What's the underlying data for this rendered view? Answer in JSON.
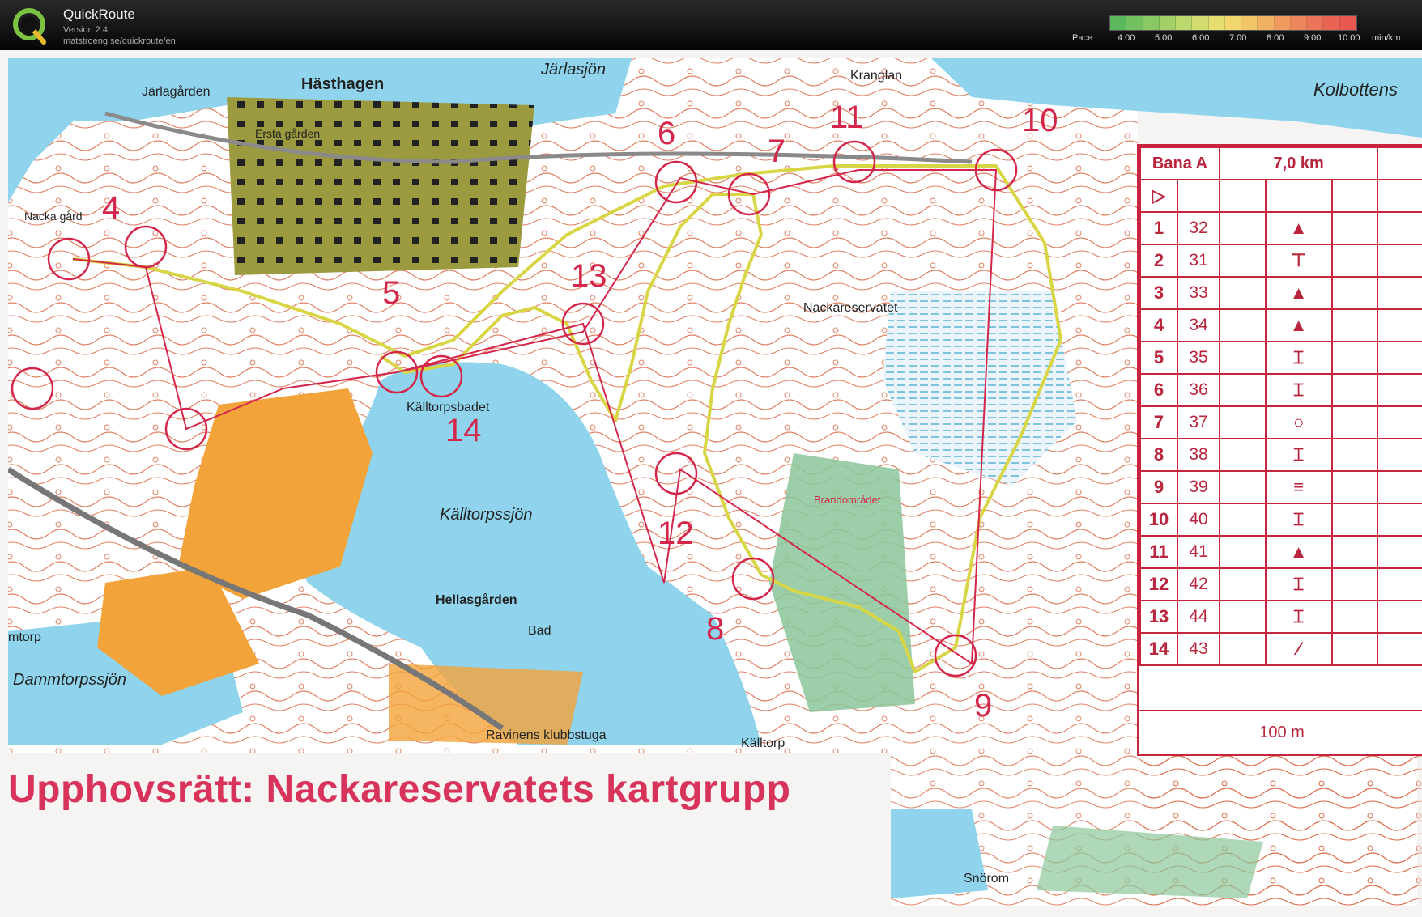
{
  "app": {
    "title": "QuickRoute",
    "version": "Version 2.4",
    "url": "matstroeng.se/quickroute/en"
  },
  "pace": {
    "label": "Pace",
    "ticks": [
      "4:00",
      "5:00",
      "6:00",
      "7:00",
      "8:00",
      "9:00",
      "10:00"
    ],
    "unit": "min/km",
    "colors": [
      "#5cb85c",
      "#72c060",
      "#8ac864",
      "#a4d068",
      "#bcd86c",
      "#d2dc6e",
      "#e6de6e",
      "#f0d66c",
      "#f2c468",
      "#f2b064",
      "#f09a60",
      "#ee865c",
      "#ec7458",
      "#ea6454",
      "#e85850"
    ]
  },
  "map": {
    "place_names": [
      {
        "text": "Hästhagen",
        "bold": true
      },
      {
        "text": "Järlagården",
        "bold": false
      },
      {
        "text": "Ersta gården",
        "bold": false
      },
      {
        "text": "Järlasjön",
        "italic": true
      },
      {
        "text": "Kranglan",
        "bold": false
      },
      {
        "text": "Kolbottens",
        "italic": true
      },
      {
        "text": "Nackareservatet",
        "bold": false
      },
      {
        "text": "Källtorpsbadet",
        "bold": false
      },
      {
        "text": "Källtorpssjön",
        "italic": true
      },
      {
        "text": "Hellasgården",
        "bold": true
      },
      {
        "text": "Bad",
        "bold": false
      },
      {
        "text": "Dammtorpssjön",
        "italic": true
      },
      {
        "text": "mtorp",
        "bold": false
      },
      {
        "text": "Ravinens klubbstuga",
        "bold": false
      },
      {
        "text": "Källtorp",
        "bold": false
      },
      {
        "text": "Brandområdet",
        "bold": false
      },
      {
        "text": "Snörom",
        "bold": false
      },
      {
        "text": "Nacka gård",
        "bold": false
      }
    ],
    "control_numbers": [
      "4",
      "5",
      "6",
      "7",
      "8",
      "9",
      "10",
      "11",
      "12",
      "13",
      "14"
    ],
    "copyright": "Upphovsrätt: Nackareservatets kartgrupp",
    "colors": {
      "water": "#8fd4ec",
      "land": "#ffffff",
      "contour": "#d6562f",
      "course": "#d4264a",
      "route": "#d9d645",
      "urban": "#9c9a3e",
      "open": "#f2a33a",
      "forest": "#8bc79a"
    }
  },
  "control_description": {
    "course": "Bana A",
    "length": "7,0 km",
    "scale": "100 m",
    "rows": [
      {
        "num": "1",
        "code": "32",
        "symbol": "▲"
      },
      {
        "num": "2",
        "code": "31",
        "symbol": "⊤"
      },
      {
        "num": "3",
        "code": "33",
        "symbol": "▲"
      },
      {
        "num": "4",
        "code": "34",
        "symbol": "▲"
      },
      {
        "num": "5",
        "code": "35",
        "symbol": "⌶"
      },
      {
        "num": "6",
        "code": "36",
        "symbol": "⌶"
      },
      {
        "num": "7",
        "code": "37",
        "symbol": "○"
      },
      {
        "num": "8",
        "code": "38",
        "symbol": "⌶"
      },
      {
        "num": "9",
        "code": "39",
        "symbol": "≡"
      },
      {
        "num": "10",
        "code": "40",
        "symbol": "⌶"
      },
      {
        "num": "11",
        "code": "41",
        "symbol": "▲"
      },
      {
        "num": "12",
        "code": "42",
        "symbol": "⌶"
      },
      {
        "num": "13",
        "code": "44",
        "symbol": "⌶"
      },
      {
        "num": "14",
        "code": "43",
        "symbol": "⁄"
      }
    ]
  }
}
